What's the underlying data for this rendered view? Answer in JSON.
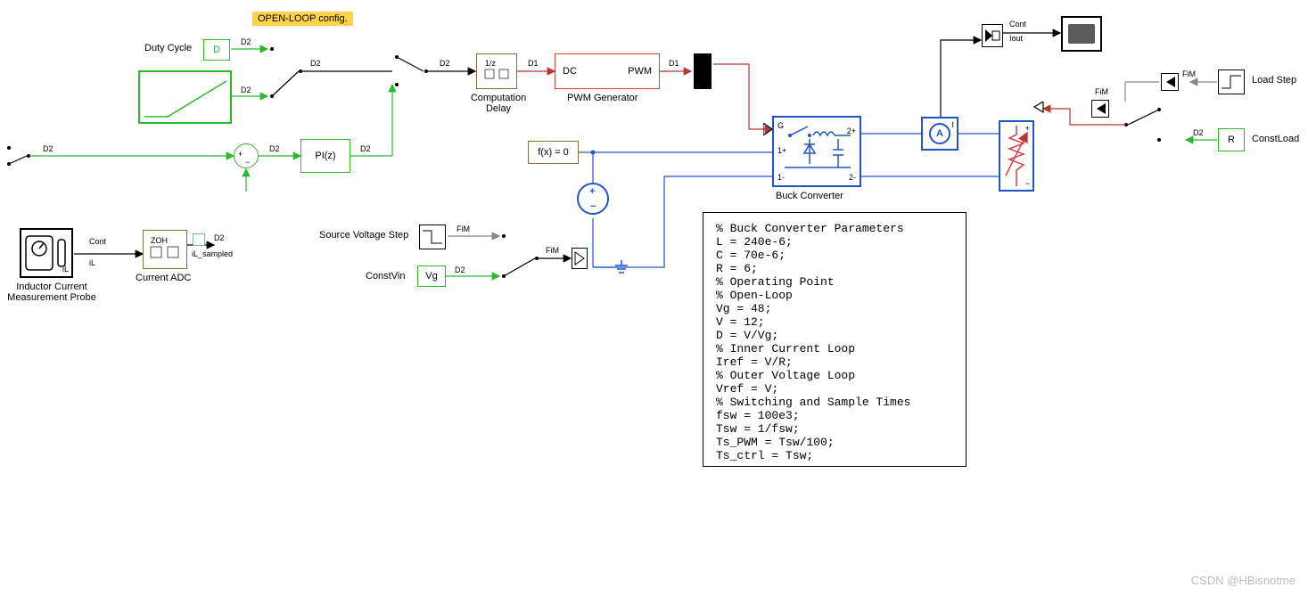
{
  "header": {
    "highlight": "OPEN-LOOP config."
  },
  "labels": {
    "duty_cycle": "Duty Cycle",
    "D": "D",
    "computation_delay": "Computation\nDelay",
    "pwm_generator": "PWM Generator",
    "pi": "PI(z)",
    "fx0": "f(x) = 0",
    "buck_converter": "Buck Converter",
    "vg": "Vg",
    "const_vin": "ConstVin",
    "src_v_step": "Source Voltage Step",
    "ilcm_probe": "Inductor Current\nMeasurement Probe",
    "current_adc": "Current ADC",
    "il": "iL",
    "il_sampled": "iL_sampled",
    "cont": "Cont",
    "iout": "Iout",
    "load_step": "Load Step",
    "const_load": "ConstLoad",
    "dc": "DC",
    "pwm": "PWM",
    "R": "R",
    "zoh": "ZOH",
    "unit_delay": "1/z",
    "A": "A"
  },
  "ports": {
    "G": "G",
    "plus1": "1+",
    "minus1": "1-",
    "plus2": "2+",
    "minus2": "2-",
    "I": "I"
  },
  "signal_tags": {
    "D2": "D2",
    "D1": "D1",
    "FiM": "FiM",
    "Cont": "Cont"
  },
  "params": [
    "% Buck Converter Parameters",
    "L = 240e-6;",
    "C = 70e-6;",
    "R = 6;",
    "% Operating Point",
    "% Open-Loop",
    "Vg = 48;",
    "V = 12;",
    "D = V/Vg;",
    "% Inner Current Loop",
    "Iref = V/R;",
    "% Outer Voltage Loop",
    "Vref = V;",
    "% Switching and Sample Times",
    "fsw = 100e3;",
    "Tsw = 1/fsw;",
    "Ts_PWM = Tsw/100;",
    "Ts_ctrl = Tsw;"
  ],
  "watermark": "CSDN @HBisnotme"
}
